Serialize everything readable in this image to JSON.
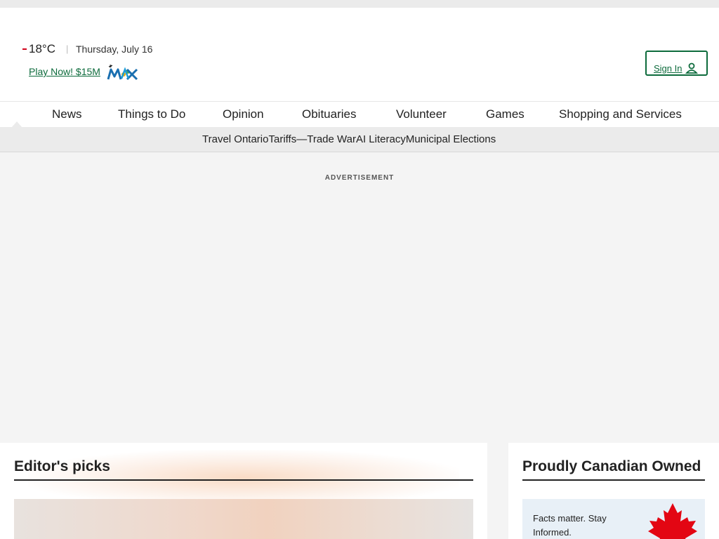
{
  "header": {
    "temperature": "18°C",
    "separator": "|",
    "date": "Thursday, July 16",
    "lottery_link": "Play Now! $15M",
    "lottery_logo_text": "MAX",
    "signin_label": "Sign In"
  },
  "nav": {
    "items": [
      {
        "label": "News"
      },
      {
        "label": "Things to Do"
      },
      {
        "label": "Opinion"
      },
      {
        "label": "Obituaries"
      },
      {
        "label": "Volunteer"
      },
      {
        "label": "Games"
      },
      {
        "label": "Shopping and Services"
      }
    ]
  },
  "subnav": {
    "items": [
      {
        "label": "Travel Ontario"
      },
      {
        "label": "Tariffs—Trade War"
      },
      {
        "label": "AI Literacy"
      },
      {
        "label": "Municipal Elections"
      }
    ]
  },
  "ad": {
    "label": "ADVERTISEMENT"
  },
  "editors_picks": {
    "title": "Editor's picks"
  },
  "canadian": {
    "title": "Proudly Canadian Owned",
    "promo_text": "Facts matter. Stay Informed."
  },
  "colors": {
    "brand_green": "#0d6b3c",
    "weather_red": "#d0021b",
    "maple_red": "#e30613"
  },
  "icons": {
    "signin": "user-icon",
    "maple": "maple-leaf-icon",
    "lottery": "lotto-max-logo"
  }
}
